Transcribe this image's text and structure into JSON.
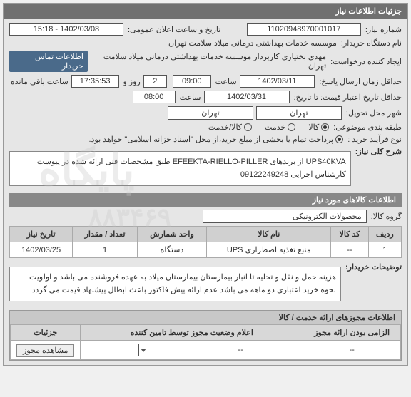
{
  "header": {
    "title": "جزئیات اطلاعات نیاز"
  },
  "fields": {
    "need_no_label": "شماره نیاز:",
    "need_no": "11020948970001017",
    "announce_label": "تاریخ و ساعت اعلان عمومی:",
    "announce": "1402/03/08 - 15:18",
    "buyer_device_label": "نام دستگاه خریدار:",
    "buyer_device": "موسسه خدمات بهداشتی درمانی میلاد سلامت تهران",
    "creator_label": "ایجاد کننده درخواست:",
    "creator": "مهدی بختیاری کاربردار موسسه خدمات بهداشتی درمانی میلاد سلامت تهران",
    "contact_btn": "اطلاعات تماس خریدار",
    "deadline_min_label": "حداقل زمان ارسال پاسخ:",
    "deadline_date": "1402/03/11",
    "time_label": "ساعت",
    "deadline_time": "09:00",
    "day_label": "روز و",
    "days_remain": "2",
    "remain_time": "17:35:53",
    "remain_suffix": "ساعت باقی مانده",
    "valid_to_label": "حداقل تاریخ اعتبار قیمت: تا تاریخ:",
    "valid_to_date": "1402/03/31",
    "valid_to_time": "08:00",
    "delivery_city_label": "شهر محل تحویل:",
    "delivery_city": "تهران",
    "delivery_city2": "تهران",
    "type_label": "طبقه بندی موضوعی:",
    "type_opts": {
      "goods": "کالا",
      "service": "خدمت",
      "goods_service": "کالا/خدمت"
    },
    "purchase_label": "نوع فرآیند خرید :",
    "purchase_note": "پرداخت تمام یا بخشی از مبلغ خرید،از محل \"اسناد خزانه اسلامی\" خواهد بود.",
    "need_title_label": "شرح کلی نیاز:",
    "need_title": "UPS40KVA از برندهای EFEEKTA-RIELLO-PILLER طبق مشخصات فنی ارائه شده در پیوست کارشناس اجرایی 09122249248",
    "goods_section": "اطلاعات کالاهای مورد نیاز",
    "goods_group_label": "گروه کالا:",
    "goods_group": "محصولات الکترونیکی",
    "table": {
      "headers": [
        "ردیف",
        "کد کالا",
        "نام کالا",
        "واحد شمارش",
        "تعداد / مقدار",
        "تاریخ نیاز"
      ],
      "row": [
        "1",
        "--",
        "منبع تغذیه اضطراری UPS",
        "دستگاه",
        "1",
        "1402/03/25"
      ]
    },
    "buyer_notes_label": "توضیحات خریدار:",
    "buyer_notes": "هزینه حمل و نقل و تخلیه تا انبار بیمارستان بیمارستان میلاد به عهده فروشنده می باشد و اولویت نحوه خرید اعتباری دو ماهه می باشد عدم ارائه پیش فاکتور باعث ابطال پیشنهاد قیمت می گردد",
    "permits_title": "اطلاعات مجوزهای ارائه خدمت / کالا",
    "perm_table": {
      "h1": "الزامی بودن ارائه مجوز",
      "h2": "اعلام وضعیت مجوز توسط تامین کننده",
      "h3": "جزئیات",
      "sel_placeholder": "--",
      "btn": "مشاهده مجوز"
    }
  }
}
